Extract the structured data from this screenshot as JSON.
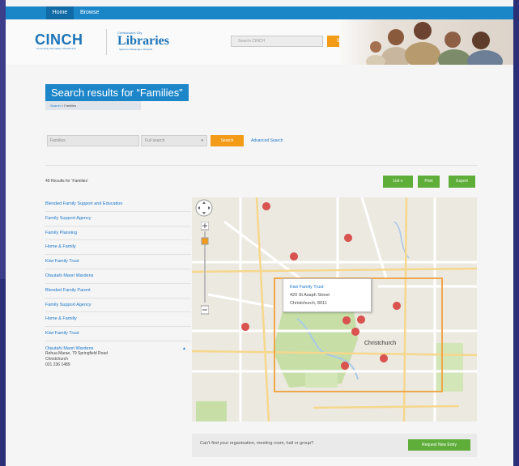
{
  "nav": {
    "home": "Home",
    "browse": "Browse"
  },
  "header": {
    "logo": "CINCH",
    "logo_sub": "Community Information Christchurch",
    "library_top": "Christchurch City",
    "library_main": "Libraries",
    "library_sub": "Ngā Kete Wānanga-o-Ōtautahi",
    "search_placeholder": "Search CINCH",
    "search_button": "Search"
  },
  "results": {
    "title": "Search results for “Families”",
    "breadcrumb_link": "Search",
    "breadcrumb_separator": " > ",
    "breadcrumb_current": "Families"
  },
  "search": {
    "input_value": "Families",
    "type_selected": "Full search",
    "button": "Search",
    "advanced": "Advanced Search"
  },
  "count_text": "49 Results for ‘Families’",
  "actions": {
    "list": "List",
    "print": "Print",
    "export": "Export"
  },
  "result_items": [
    "Blended Family Support and Education",
    "Family Support Agency",
    "Family Planning",
    "Home & Family",
    "Kiwi Family Trust",
    "Otautahi Maori Wardens",
    "Blended Family Parent",
    "Family Support Agency",
    "Home & Familiy",
    "Kiwi Family Trust"
  ],
  "expanded_item": {
    "name": "Otautahi Maori Wardens",
    "line1": "Rehua Marae, 79 Springfield Road",
    "line2": "Christchurch",
    "phone": "021 236 1489"
  },
  "map": {
    "popup_title": "Kiwi Family Trust",
    "popup_line1": "420 St Asaph Street",
    "popup_line2": "Christchurch, 8011",
    "city_label": "Christchurch"
  },
  "banner": {
    "text": "Can't find your organisation, meeting room, hall or group?",
    "button": "Request New Entry"
  },
  "colors": {
    "brand_blue": "#1d86c9",
    "accent_orange": "#f39a17",
    "action_green": "#5fae3a"
  }
}
